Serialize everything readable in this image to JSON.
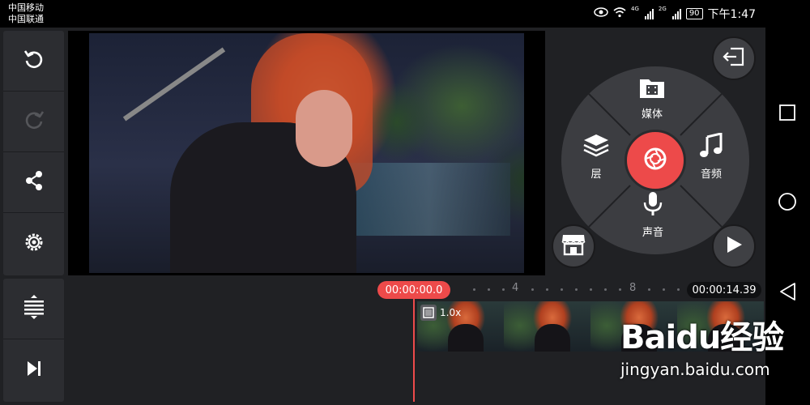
{
  "status_bar": {
    "carrier_1": "中国移动",
    "carrier_2": "中国联通",
    "net_1": "4G",
    "net_2": "2G",
    "battery": "90",
    "time": "下午1:47"
  },
  "toolbar": {
    "top": [
      "undo-icon",
      "redo-icon",
      "share-icon",
      "settings-icon"
    ],
    "bottom": [
      "timeline-expand-icon",
      "skip-to-end-icon"
    ]
  },
  "wheel": {
    "top_label": "媒体",
    "left_label": "层",
    "right_label": "音频",
    "bottom_label": "声音",
    "center_icon": "camera-shutter-icon",
    "accent_color": "#ed4a4a"
  },
  "timeline": {
    "playhead_time": "00:00:00.0",
    "total_time": "00:00:14.39",
    "tick_labels": [
      "4",
      "8"
    ],
    "clip_speed": "1.0x"
  },
  "watermark": {
    "logo": "Baidu经验",
    "url": "jingyan.baidu.com"
  }
}
